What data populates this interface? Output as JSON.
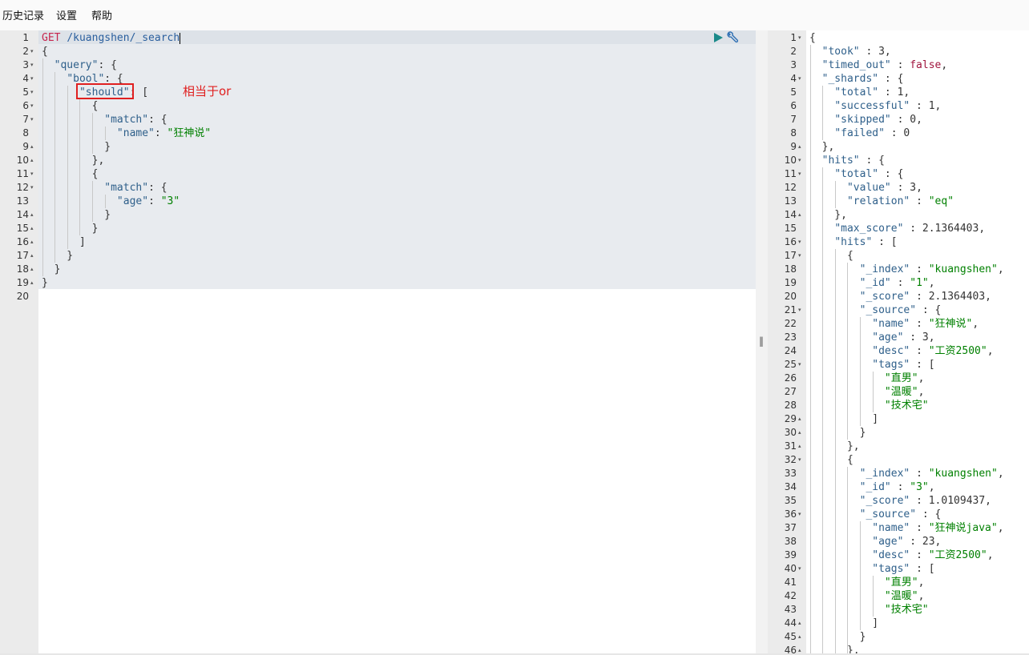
{
  "menu": {
    "history": "历史记录",
    "settings": "设置",
    "help": "帮助"
  },
  "annotation": "相当于or",
  "request": {
    "lines": [
      {
        "n": "1",
        "fold": "",
        "html": "<span class='m'>GET</span> <span class='p'>/kuangshen/_search</span>"
      },
      {
        "n": "2",
        "fold": "▾",
        "html": "{"
      },
      {
        "n": "3",
        "fold": "▾",
        "html": "  <span class='k'>\"query\"</span>: {"
      },
      {
        "n": "4",
        "fold": "▾",
        "html": "    <span class='k'>\"bool\"</span>: {"
      },
      {
        "n": "5",
        "fold": "▾",
        "html": "      <span class='k'>\"should\"</span>: ["
      },
      {
        "n": "6",
        "fold": "▾",
        "html": "        {"
      },
      {
        "n": "7",
        "fold": "▾",
        "html": "          <span class='k'>\"match\"</span>: {"
      },
      {
        "n": "8",
        "fold": "",
        "html": "            <span class='k'>\"name\"</span>: <span class='s'>\"狂神说\"</span>"
      },
      {
        "n": "9",
        "fold": "▴",
        "html": "          }"
      },
      {
        "n": "10",
        "fold": "▴",
        "html": "        },"
      },
      {
        "n": "11",
        "fold": "▾",
        "html": "        {"
      },
      {
        "n": "12",
        "fold": "▾",
        "html": "          <span class='k'>\"match\"</span>: {"
      },
      {
        "n": "13",
        "fold": "",
        "html": "            <span class='k'>\"age\"</span>: <span class='s'>\"3\"</span>"
      },
      {
        "n": "14",
        "fold": "▴",
        "html": "          }"
      },
      {
        "n": "15",
        "fold": "▴",
        "html": "        }"
      },
      {
        "n": "16",
        "fold": "▴",
        "html": "      ]"
      },
      {
        "n": "17",
        "fold": "▴",
        "html": "    }"
      },
      {
        "n": "18",
        "fold": "▴",
        "html": "  }"
      },
      {
        "n": "19",
        "fold": "▴",
        "html": "}"
      },
      {
        "n": "20",
        "fold": "",
        "html": ""
      }
    ]
  },
  "response": {
    "lines": [
      {
        "n": "1",
        "fold": "▾",
        "html": "{"
      },
      {
        "n": "2",
        "fold": "",
        "html": "  <span class='k'>\"took\"</span> : 3,"
      },
      {
        "n": "3",
        "fold": "",
        "html": "  <span class='k'>\"timed_out\"</span> : <span class='b'>false</span>,"
      },
      {
        "n": "4",
        "fold": "▾",
        "html": "  <span class='k'>\"_shards\"</span> : {"
      },
      {
        "n": "5",
        "fold": "",
        "html": "    <span class='k'>\"total\"</span> : 1,"
      },
      {
        "n": "6",
        "fold": "",
        "html": "    <span class='k'>\"successful\"</span> : 1,"
      },
      {
        "n": "7",
        "fold": "",
        "html": "    <span class='k'>\"skipped\"</span> : 0,"
      },
      {
        "n": "8",
        "fold": "",
        "html": "    <span class='k'>\"failed\"</span> : 0"
      },
      {
        "n": "9",
        "fold": "▴",
        "html": "  },"
      },
      {
        "n": "10",
        "fold": "▾",
        "html": "  <span class='k'>\"hits\"</span> : {"
      },
      {
        "n": "11",
        "fold": "▾",
        "html": "    <span class='k'>\"total\"</span> : {"
      },
      {
        "n": "12",
        "fold": "",
        "html": "      <span class='k'>\"value\"</span> : 3,"
      },
      {
        "n": "13",
        "fold": "",
        "html": "      <span class='k'>\"relation\"</span> : <span class='s'>\"eq\"</span>"
      },
      {
        "n": "14",
        "fold": "▴",
        "html": "    },"
      },
      {
        "n": "15",
        "fold": "",
        "html": "    <span class='k'>\"max_score\"</span> : 2.1364403,"
      },
      {
        "n": "16",
        "fold": "▾",
        "html": "    <span class='k'>\"hits\"</span> : ["
      },
      {
        "n": "17",
        "fold": "▾",
        "html": "      {"
      },
      {
        "n": "18",
        "fold": "",
        "html": "        <span class='k'>\"_index\"</span> : <span class='s'>\"kuangshen\"</span>,"
      },
      {
        "n": "19",
        "fold": "",
        "html": "        <span class='k'>\"_id\"</span> : <span class='s'>\"1\"</span>,"
      },
      {
        "n": "20",
        "fold": "",
        "html": "        <span class='k'>\"_score\"</span> : 2.1364403,"
      },
      {
        "n": "21",
        "fold": "▾",
        "html": "        <span class='k'>\"_source\"</span> : {"
      },
      {
        "n": "22",
        "fold": "",
        "html": "          <span class='k'>\"name\"</span> : <span class='s'>\"狂神说\"</span>,"
      },
      {
        "n": "23",
        "fold": "",
        "html": "          <span class='k'>\"age\"</span> : 3,"
      },
      {
        "n": "24",
        "fold": "",
        "html": "          <span class='k'>\"desc\"</span> : <span class='s'>\"工资2500\"</span>,"
      },
      {
        "n": "25",
        "fold": "▾",
        "html": "          <span class='k'>\"tags\"</span> : ["
      },
      {
        "n": "26",
        "fold": "",
        "html": "            <span class='s'>\"直男\"</span>,"
      },
      {
        "n": "27",
        "fold": "",
        "html": "            <span class='s'>\"温暖\"</span>,"
      },
      {
        "n": "28",
        "fold": "",
        "html": "            <span class='s'>\"技术宅\"</span>"
      },
      {
        "n": "29",
        "fold": "▴",
        "html": "          ]"
      },
      {
        "n": "30",
        "fold": "▴",
        "html": "        }"
      },
      {
        "n": "31",
        "fold": "▴",
        "html": "      },"
      },
      {
        "n": "32",
        "fold": "▾",
        "html": "      {"
      },
      {
        "n": "33",
        "fold": "",
        "html": "        <span class='k'>\"_index\"</span> : <span class='s'>\"kuangshen\"</span>,"
      },
      {
        "n": "34",
        "fold": "",
        "html": "        <span class='k'>\"_id\"</span> : <span class='s'>\"3\"</span>,"
      },
      {
        "n": "35",
        "fold": "",
        "html": "        <span class='k'>\"_score\"</span> : 1.0109437,"
      },
      {
        "n": "36",
        "fold": "▾",
        "html": "        <span class='k'>\"_source\"</span> : {"
      },
      {
        "n": "37",
        "fold": "",
        "html": "          <span class='k'>\"name\"</span> : <span class='s'>\"狂神说java\"</span>,"
      },
      {
        "n": "38",
        "fold": "",
        "html": "          <span class='k'>\"age\"</span> : 23,"
      },
      {
        "n": "39",
        "fold": "",
        "html": "          <span class='k'>\"desc\"</span> : <span class='s'>\"工资2500\"</span>,"
      },
      {
        "n": "40",
        "fold": "▾",
        "html": "          <span class='k'>\"tags\"</span> : ["
      },
      {
        "n": "41",
        "fold": "",
        "html": "            <span class='s'>\"直男\"</span>,"
      },
      {
        "n": "42",
        "fold": "",
        "html": "            <span class='s'>\"温暖\"</span>,"
      },
      {
        "n": "43",
        "fold": "",
        "html": "            <span class='s'>\"技术宅\"</span>"
      },
      {
        "n": "44",
        "fold": "▴",
        "html": "          ]"
      },
      {
        "n": "45",
        "fold": "▴",
        "html": "        }"
      },
      {
        "n": "46",
        "fold": "▴",
        "html": "      },"
      }
    ]
  },
  "colors": {
    "key": "#2e5f8a",
    "string": "#008000",
    "method": "#c7254e",
    "annotation": "#e02020"
  },
  "icons": [
    "play-icon",
    "wrench-icon",
    "split-handle-icon"
  ]
}
